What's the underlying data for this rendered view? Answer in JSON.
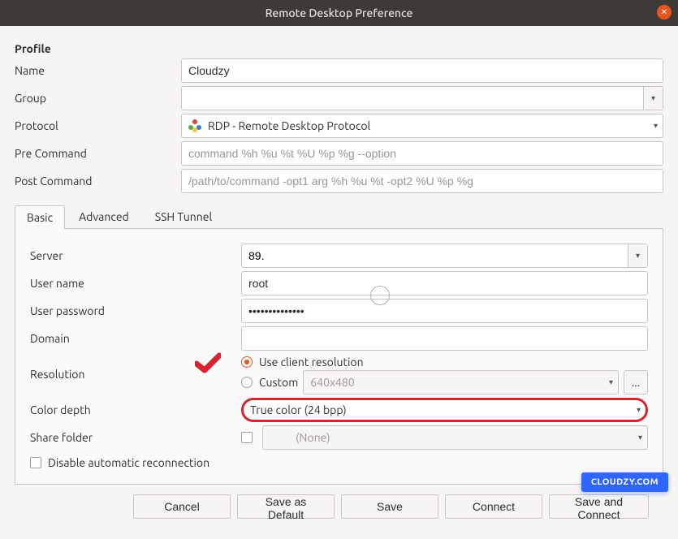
{
  "window": {
    "title": "Remote Desktop Preference"
  },
  "profile": {
    "heading": "Profile",
    "name_label": "Name",
    "name_value": "Cloudzy",
    "group_label": "Group",
    "group_value": "",
    "protocol_label": "Protocol",
    "protocol_value": "RDP - Remote Desktop Protocol",
    "precommand_label": "Pre Command",
    "precommand_placeholder": "command %h %u %t %U %p %g --option",
    "precommand_value": "",
    "postcommand_label": "Post Command",
    "postcommand_placeholder": "/path/to/command -opt1 arg %h %u %t -opt2 %U %p %g",
    "postcommand_value": ""
  },
  "tabs": {
    "basic": "Basic",
    "advanced": "Advanced",
    "ssh": "SSH Tunnel",
    "active": "basic"
  },
  "basic": {
    "server_label": "Server",
    "server_value": "89.",
    "user_label": "User name",
    "user_value": "root",
    "password_label": "User password",
    "password_value": "••••••••••••••",
    "domain_label": "Domain",
    "domain_value": "",
    "resolution_label": "Resolution",
    "resolution_option_client": "Use client resolution",
    "resolution_option_custom": "Custom",
    "resolution_custom_value": "640x480",
    "resolution_more": "...",
    "colordepth_label": "Color depth",
    "colordepth_value": "True color (24 bpp)",
    "share_label": "Share folder",
    "share_value": "(None)",
    "disable_auto_label": "Disable automatic reconnection"
  },
  "buttons": {
    "cancel": "Cancel",
    "save_default": "Save as Default",
    "save": "Save",
    "connect": "Connect",
    "save_connect": "Save and Connect"
  },
  "badge": "CLOUDZY.COM"
}
